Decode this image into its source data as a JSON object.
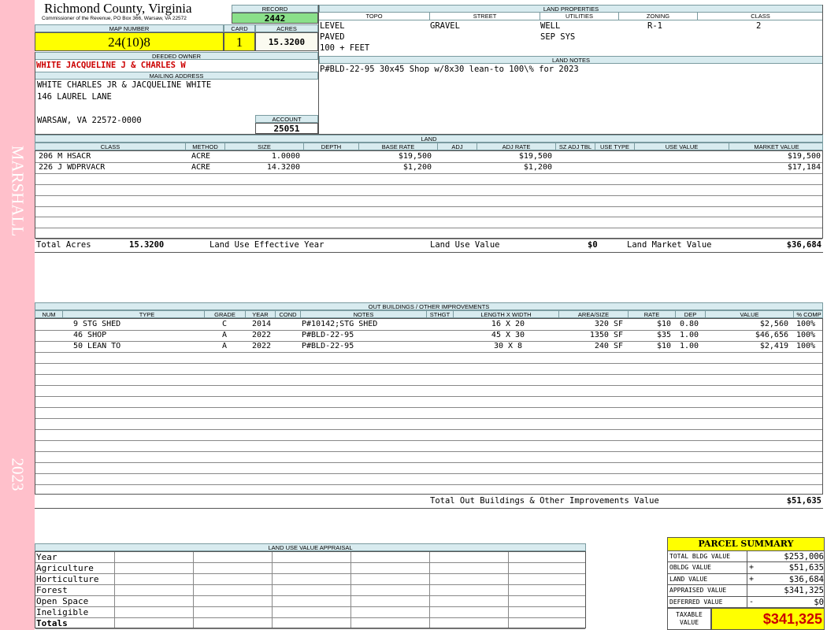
{
  "sidebar": {
    "name": "MARSHALL",
    "year": "2023"
  },
  "header": {
    "county": "Richmond County, Virginia",
    "commissioner": "Commissioner of the Revenue, PO Box 366, Warsaw, VA 22572",
    "record_label": "RECORD",
    "record": "2442",
    "map_number_label": "MAP NUMBER",
    "map_number": "24(10)8",
    "card_label": "CARD",
    "card": "1",
    "acres_label": "ACRES",
    "acres": "15.3200"
  },
  "owner": {
    "deeded_owner_label": "DEEDED OWNER",
    "deeded_owner": "WHITE JACQUELINE J & CHARLES W",
    "mailing_label": "MAILING ADDRESS",
    "mailing_line1": "WHITE CHARLES JR & JACQUELINE WHITE",
    "mailing_line2": "146 LAUREL LANE",
    "mailing_line3": "WARSAW, VA 22572-0000",
    "account_label": "ACCOUNT",
    "account": "25051"
  },
  "land_properties": {
    "title": "LAND PROPERTIES",
    "headers": [
      "TOPO",
      "STREET",
      "UTILITIES",
      "ZONING",
      "CLASS"
    ],
    "topo": [
      "LEVEL",
      "PAVED",
      "100 + FEET"
    ],
    "street": [
      "GRAVEL"
    ],
    "utilities": [
      "WELL",
      "SEP SYS"
    ],
    "zoning": "R-1",
    "class": "2"
  },
  "land_notes": {
    "title": "LAND NOTES",
    "text": "P#BLD-22-95 30x45 Shop w/8x30 lean-to 100\\% for 2023"
  },
  "land": {
    "title": "LAND",
    "headers": [
      "CLASS",
      "METHOD",
      "SIZE",
      "DEPTH",
      "BASE RATE",
      "ADJ",
      "ADJ RATE",
      "SZ ADJ TBL",
      "USE TYPE",
      "USE VALUE",
      "MARKET VALUE"
    ],
    "rows": [
      {
        "class": "206 M HSACR",
        "method": "ACRE",
        "size": "1.0000",
        "base_rate": "$19,500",
        "adj_rate": "$19,500",
        "market": "$19,500"
      },
      {
        "class": "226 J WDPRVACR",
        "method": "ACRE",
        "size": "14.3200",
        "base_rate": "$1,200",
        "adj_rate": "$1,200",
        "market": "$17,184"
      }
    ],
    "total_acres_label": "Total Acres",
    "total_acres": "15.3200",
    "effective_year_label": "Land Use Effective Year",
    "use_value_label": "Land Use Value",
    "use_value": "$0",
    "market_value_label": "Land Market Value",
    "market_value": "$36,684"
  },
  "outbuildings": {
    "title": "OUT BUILDINGS / OTHER IMPROVEMENTS",
    "headers": [
      "NUM",
      "TYPE",
      "GRADE",
      "YEAR",
      "COND",
      "NOTES",
      "STHGT",
      "LENGTH X WIDTH",
      "AREA/SIZE",
      "RATE",
      "DEP",
      "VALUE",
      "% COMP"
    ],
    "rows": [
      {
        "type": "9 STG SHED",
        "grade": "C",
        "year": "2014",
        "notes": "P#10142;STG SHED",
        "lxw": "16 X 20",
        "area": "320 SF",
        "rate": "$10",
        "dep": "0.80",
        "value": "$2,560",
        "comp": "100%"
      },
      {
        "type": "46 SHOP",
        "grade": "A",
        "year": "2022",
        "notes": "P#BLD-22-95",
        "lxw": "45 X 30",
        "area": "1350 SF",
        "rate": "$35",
        "dep": "1.00",
        "value": "$46,656",
        "comp": "100%"
      },
      {
        "type": "50 LEAN TO",
        "grade": "A",
        "year": "2022",
        "notes": "P#BLD-22-95",
        "lxw": "30 X 8",
        "area": "240 SF",
        "rate": "$10",
        "dep": "1.00",
        "value": "$2,419",
        "comp": "100%"
      }
    ],
    "total_label": "Total Out Buildings & Other Improvements Value",
    "total": "$51,635"
  },
  "land_use_appraisal": {
    "title": "LAND USE VALUE APPRAISAL",
    "rows": [
      "Year",
      "Agriculture",
      "Horticulture",
      "Forest",
      "Open Space",
      "Ineligible",
      "Totals"
    ]
  },
  "parcel_summary": {
    "title": "PARCEL SUMMARY",
    "rows": [
      {
        "label": "TOTAL BLDG VALUE",
        "op": "",
        "value": "$253,006"
      },
      {
        "label": "OBLDG VALUE",
        "op": "+",
        "value": "$51,635"
      },
      {
        "label": "LAND VALUE",
        "op": "+",
        "value": "$36,684"
      },
      {
        "label": "APPRAISED VALUE",
        "op": "",
        "value": "$341,325"
      },
      {
        "label": "DEFERRED VALUE",
        "op": "-",
        "value": "$0"
      }
    ],
    "taxable_label_1": "TAXABLE",
    "taxable_label_2": "VALUE",
    "taxable_value": "$341,325"
  }
}
